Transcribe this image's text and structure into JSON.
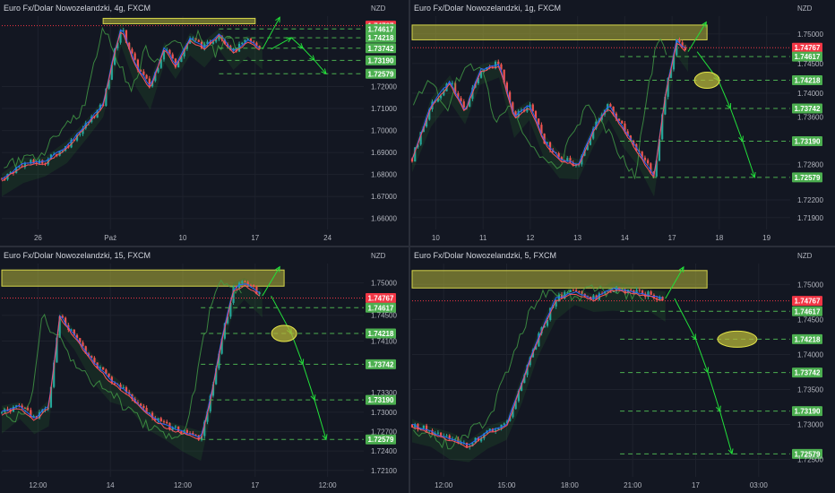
{
  "colors": {
    "background": "#131722",
    "grid": "#1e222d",
    "up": "#26a69a",
    "down": "#ef5350",
    "zone_fill": "#b5b53a",
    "level_line": "#4caf50",
    "badge_green": "#4caf50",
    "badge_red": "#f23645",
    "arrow": "#22e03a",
    "tenkan": "#2962ff",
    "kijun": "#f7525f",
    "chikou": "#43a047",
    "kumo_fill": "#2e7d32"
  },
  "chart_data": [
    {
      "type": "candlestick",
      "title": "Euro Fx/Dolar Nowozelandzki, 4g, FXCM",
      "unit_label": "NZD",
      "y_ticks": [
        "1.72000",
        "1.71000",
        "1.70000",
        "1.69000",
        "1.68000",
        "1.67000",
        "1.66000"
      ],
      "x_ticks": [
        "26",
        "Paź",
        "10",
        "17",
        "24"
      ],
      "ylim": [
        1.655,
        1.752
      ],
      "levels": [
        {
          "label": "1.74767",
          "value": 1.74767,
          "kind": "current"
        },
        {
          "label": "1.74617",
          "value": 1.74617,
          "kind": "level"
        },
        {
          "label": "1.74218",
          "value": 1.74218,
          "kind": "level"
        },
        {
          "label": "1.73742",
          "value": 1.73742,
          "kind": "level"
        },
        {
          "label": "1.73190",
          "value": 1.7319,
          "kind": "level"
        },
        {
          "label": "1.72579",
          "value": 1.72579,
          "kind": "level"
        }
      ],
      "zone": {
        "from": 1.749,
        "to": 1.751
      },
      "price_path": [
        {
          "x": 0.0,
          "y": 1.678
        },
        {
          "x": 0.06,
          "y": 1.685
        },
        {
          "x": 0.12,
          "y": 1.686
        },
        {
          "x": 0.18,
          "y": 1.693
        },
        {
          "x": 0.24,
          "y": 1.704
        },
        {
          "x": 0.28,
          "y": 1.712
        },
        {
          "x": 0.31,
          "y": 1.735
        },
        {
          "x": 0.33,
          "y": 1.747
        },
        {
          "x": 0.37,
          "y": 1.73
        },
        {
          "x": 0.41,
          "y": 1.72
        },
        {
          "x": 0.45,
          "y": 1.738
        },
        {
          "x": 0.48,
          "y": 1.73
        },
        {
          "x": 0.52,
          "y": 1.742
        },
        {
          "x": 0.56,
          "y": 1.738
        },
        {
          "x": 0.6,
          "y": 1.744
        },
        {
          "x": 0.64,
          "y": 1.736
        },
        {
          "x": 0.68,
          "y": 1.741
        },
        {
          "x": 0.72,
          "y": 1.737
        }
      ]
    },
    {
      "type": "candlestick",
      "title": "Euro Fx/Dolar Nowozelandzki, 1g, FXCM",
      "unit_label": "NZD",
      "y_ticks": [
        "1.75000",
        "1.74500",
        "1.74000",
        "1.73600",
        "1.72800",
        "1.72200",
        "1.71900"
      ],
      "x_ticks": [
        "10",
        "11",
        "12",
        "13",
        "14",
        "17",
        "18",
        "19"
      ],
      "ylim": [
        1.717,
        1.753
      ],
      "levels": [
        {
          "label": "1.74767",
          "value": 1.74767,
          "kind": "current"
        },
        {
          "label": "1.74617",
          "value": 1.74617,
          "kind": "level"
        },
        {
          "label": "1.74218",
          "value": 1.74218,
          "kind": "level"
        },
        {
          "label": "1.73742",
          "value": 1.73742,
          "kind": "level"
        },
        {
          "label": "1.73190",
          "value": 1.7319,
          "kind": "level"
        },
        {
          "label": "1.72579",
          "value": 1.72579,
          "kind": "level"
        }
      ],
      "zone": {
        "from": 1.749,
        "to": 1.7515
      },
      "price_path": [
        {
          "x": 0.0,
          "y": 1.729
        },
        {
          "x": 0.05,
          "y": 1.738
        },
        {
          "x": 0.1,
          "y": 1.742
        },
        {
          "x": 0.14,
          "y": 1.737
        },
        {
          "x": 0.18,
          "y": 1.744
        },
        {
          "x": 0.23,
          "y": 1.745
        },
        {
          "x": 0.27,
          "y": 1.736
        },
        {
          "x": 0.31,
          "y": 1.738
        },
        {
          "x": 0.35,
          "y": 1.732
        },
        {
          "x": 0.39,
          "y": 1.729
        },
        {
          "x": 0.44,
          "y": 1.728
        },
        {
          "x": 0.48,
          "y": 1.734
        },
        {
          "x": 0.52,
          "y": 1.738
        },
        {
          "x": 0.56,
          "y": 1.734
        },
        {
          "x": 0.6,
          "y": 1.73
        },
        {
          "x": 0.64,
          "y": 1.726
        },
        {
          "x": 0.67,
          "y": 1.74
        },
        {
          "x": 0.7,
          "y": 1.749
        },
        {
          "x": 0.73,
          "y": 1.747
        }
      ]
    },
    {
      "type": "candlestick",
      "title": "Euro Fx/Dolar Nowozelandzki, 15, FXCM",
      "unit_label": "NZD",
      "y_ticks": [
        "1.75000",
        "1.74500",
        "1.74100",
        "1.73300",
        "1.73000",
        "1.72700",
        "1.72400",
        "1.72100"
      ],
      "x_ticks": [
        "12:00",
        "14",
        "12:00",
        "17",
        "12:00"
      ],
      "ylim": [
        1.72,
        1.753
      ],
      "levels": [
        {
          "label": "1.74767",
          "value": 1.74767,
          "kind": "current"
        },
        {
          "label": "1.74617",
          "value": 1.74617,
          "kind": "level"
        },
        {
          "label": "1.74218",
          "value": 1.74218,
          "kind": "level"
        },
        {
          "label": "1.73742",
          "value": 1.73742,
          "kind": "level"
        },
        {
          "label": "1.73190",
          "value": 1.7319,
          "kind": "level"
        },
        {
          "label": "1.72579",
          "value": 1.72579,
          "kind": "level"
        }
      ],
      "zone": {
        "from": 1.7495,
        "to": 1.752
      },
      "price_path": [
        {
          "x": 0.0,
          "y": 1.73
        },
        {
          "x": 0.05,
          "y": 1.731
        },
        {
          "x": 0.09,
          "y": 1.729
        },
        {
          "x": 0.13,
          "y": 1.731
        },
        {
          "x": 0.16,
          "y": 1.745
        },
        {
          "x": 0.2,
          "y": 1.742
        },
        {
          "x": 0.25,
          "y": 1.738
        },
        {
          "x": 0.3,
          "y": 1.735
        },
        {
          "x": 0.35,
          "y": 1.733
        },
        {
          "x": 0.4,
          "y": 1.73
        },
        {
          "x": 0.45,
          "y": 1.728
        },
        {
          "x": 0.5,
          "y": 1.727
        },
        {
          "x": 0.55,
          "y": 1.726
        },
        {
          "x": 0.58,
          "y": 1.733
        },
        {
          "x": 0.61,
          "y": 1.742
        },
        {
          "x": 0.64,
          "y": 1.749
        },
        {
          "x": 0.67,
          "y": 1.75
        },
        {
          "x": 0.72,
          "y": 1.748
        }
      ]
    },
    {
      "type": "candlestick",
      "title": "Euro Fx/Dolar Nowozelandzki, 5, FXCM",
      "unit_label": "NZD",
      "y_ticks": [
        "1.75000",
        "1.74500",
        "1.74000",
        "1.73500",
        "1.73000",
        "1.72500"
      ],
      "x_ticks": [
        "12:00",
        "15:00",
        "18:00",
        "21:00",
        "17",
        "03:00"
      ],
      "ylim": [
        1.7225,
        1.753
      ],
      "levels": [
        {
          "label": "1.74767",
          "value": 1.74767,
          "kind": "current"
        },
        {
          "label": "1.74617",
          "value": 1.74617,
          "kind": "level"
        },
        {
          "label": "1.74218",
          "value": 1.74218,
          "kind": "level"
        },
        {
          "label": "1.73742",
          "value": 1.73742,
          "kind": "level"
        },
        {
          "label": "1.73190",
          "value": 1.7319,
          "kind": "level"
        },
        {
          "label": "1.72579",
          "value": 1.72579,
          "kind": "level"
        }
      ],
      "zone": {
        "from": 1.7495,
        "to": 1.752
      },
      "price_path": [
        {
          "x": 0.0,
          "y": 1.73
        },
        {
          "x": 0.05,
          "y": 1.729
        },
        {
          "x": 0.1,
          "y": 1.728
        },
        {
          "x": 0.15,
          "y": 1.727
        },
        {
          "x": 0.2,
          "y": 1.729
        },
        {
          "x": 0.25,
          "y": 1.73
        },
        {
          "x": 0.29,
          "y": 1.736
        },
        {
          "x": 0.33,
          "y": 1.742
        },
        {
          "x": 0.38,
          "y": 1.748
        },
        {
          "x": 0.43,
          "y": 1.749
        },
        {
          "x": 0.48,
          "y": 1.748
        },
        {
          "x": 0.53,
          "y": 1.7495
        },
        {
          "x": 0.58,
          "y": 1.749
        },
        {
          "x": 0.63,
          "y": 1.7485
        },
        {
          "x": 0.67,
          "y": 1.748
        }
      ]
    }
  ]
}
